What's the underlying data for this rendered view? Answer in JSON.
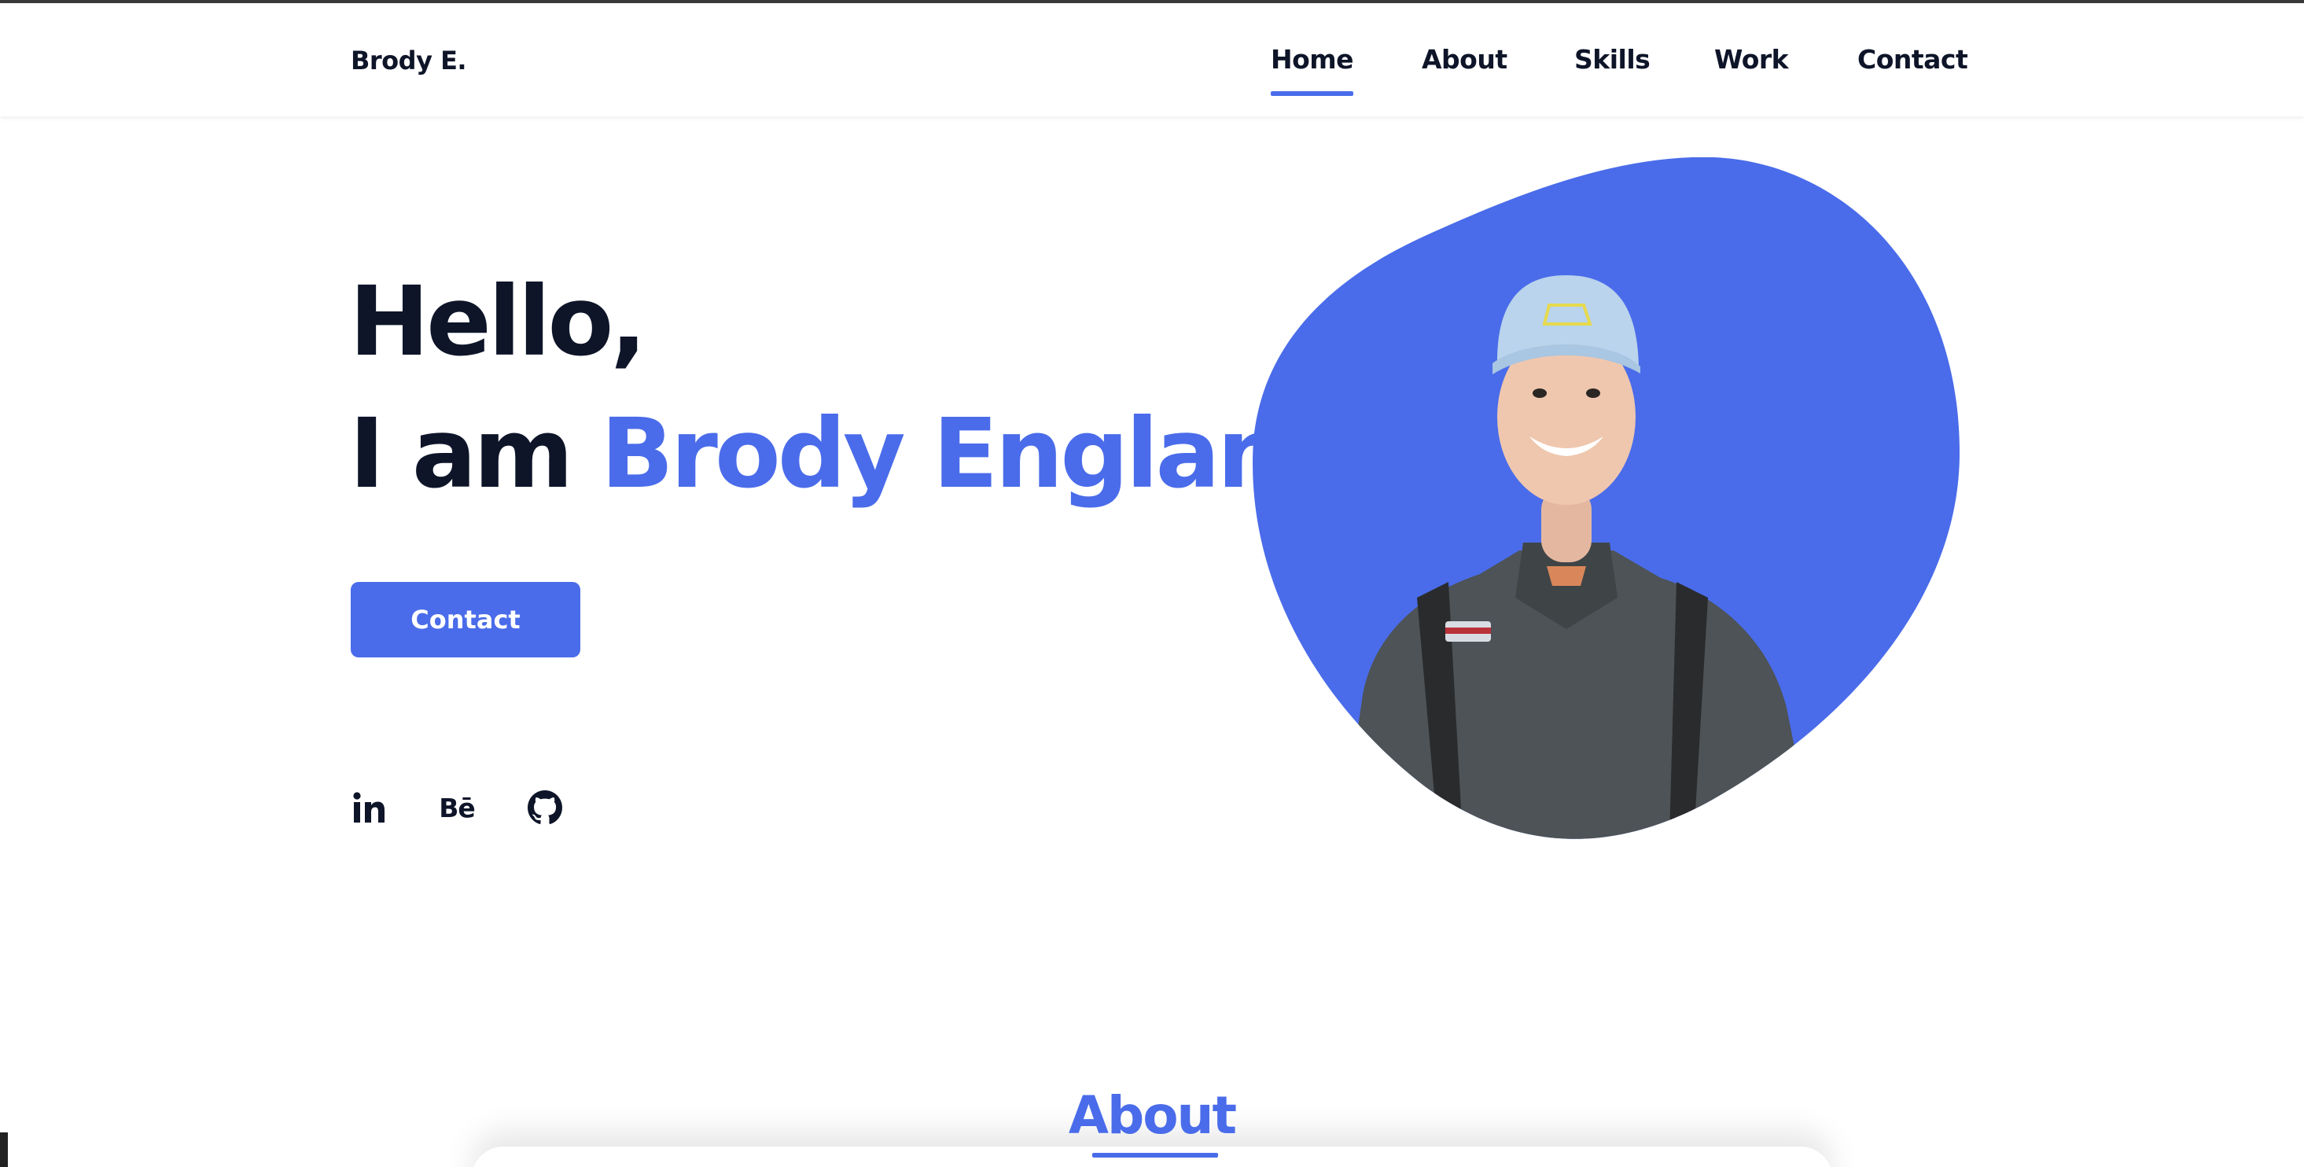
{
  "header": {
    "logo": "Brody E.",
    "nav": [
      {
        "label": "Home",
        "active": true
      },
      {
        "label": "About",
        "active": false
      },
      {
        "label": "Skills",
        "active": false
      },
      {
        "label": "Work",
        "active": false
      },
      {
        "label": "Contact",
        "active": false
      }
    ]
  },
  "hero": {
    "greeting": "Hello,",
    "intro_prefix": "I am",
    "name": "Brody England",
    "contact_button": "Contact",
    "social": [
      {
        "icon": "linkedin-icon"
      },
      {
        "icon": "behance-icon",
        "glyph": "Bē"
      },
      {
        "icon": "github-icon"
      }
    ]
  },
  "about": {
    "title": "About"
  },
  "colors": {
    "accent": "#4a6cea",
    "text": "#0e1529",
    "background": "#ffffff"
  }
}
